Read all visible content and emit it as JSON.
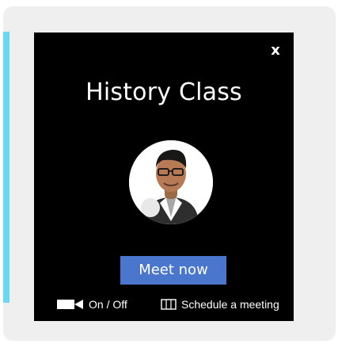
{
  "meeting": {
    "title": "History Class",
    "close_label": "x",
    "meet_now_label": "Meet now",
    "video_toggle_label": "On / Off",
    "schedule_label": "Schedule a meeting"
  },
  "icons": {
    "close": "close-icon",
    "video": "video-camera-icon",
    "calendar": "calendar-icon",
    "avatar": "avatar-image"
  },
  "colors": {
    "panel_background": "#000000",
    "button_background": "#4a77cd",
    "accent_strip": "#6ad8f3",
    "outer_background": "#efefef"
  }
}
